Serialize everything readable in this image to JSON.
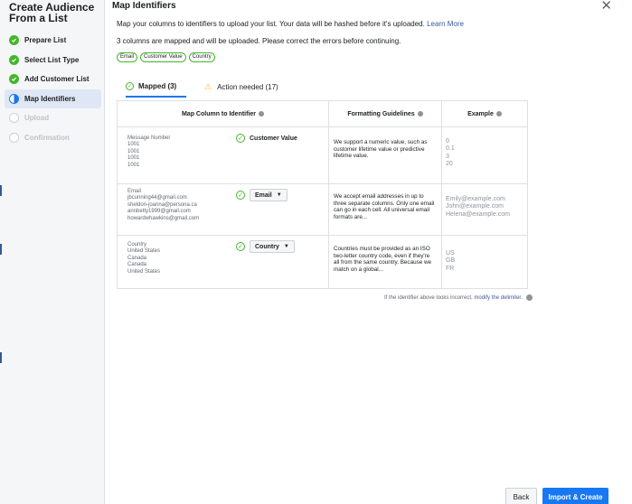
{
  "sidebar": {
    "title": "Create Audience From a List",
    "steps": [
      {
        "label": "Prepare List",
        "state": "done"
      },
      {
        "label": "Select List Type",
        "state": "done"
      },
      {
        "label": "Add Customer List",
        "state": "done"
      },
      {
        "label": "Map Identifiers",
        "state": "current"
      },
      {
        "label": "Upload",
        "state": "pending"
      },
      {
        "label": "Confirmation",
        "state": "pending"
      }
    ]
  },
  "header": {
    "title": "Map Identifiers",
    "close_glyph": "✕"
  },
  "intro": {
    "text": "Map your columns to identifiers to upload your list. Your data will be hashed before it's uploaded.",
    "link": "Learn More"
  },
  "status_line": "3 columns are mapped and will be uploaded. Please correct the errors before continuing.",
  "chips": [
    "Email",
    "Customer Value",
    "Country"
  ],
  "tabs": {
    "mapped": "Mapped (3)",
    "action": "Action needed (17)"
  },
  "table": {
    "headers": {
      "map": "Map Column to Identifier",
      "guidelines": "Formatting Guidelines",
      "example": "Example"
    },
    "rows": [
      {
        "column_values": [
          "Message Number",
          "1001",
          "1001",
          "1001",
          "1001"
        ],
        "identifier": "Customer Value",
        "identifier_type": "static",
        "guideline": "We support a numeric value, such as customer lifetime value or predictive lifetime value.",
        "examples": [
          "0",
          "0.1",
          "3",
          "20"
        ]
      },
      {
        "column_values": [
          "Email",
          "jbcunning44@gmail.com",
          "sheldon-joanna@persona.ca",
          "annbetty1999@gmail.com",
          "howardwhawkins@gmail.com"
        ],
        "identifier": "Email",
        "identifier_type": "dropdown",
        "guideline": "We accept email addresses in up to three separate columns. Only one email can go in each cell. All universal email formats are...",
        "examples": [
          "Emily@example.com",
          "John@example.com",
          "Helena@example.com"
        ]
      },
      {
        "column_values": [
          "Country",
          "United States",
          "Canada",
          "Canada",
          "United States"
        ],
        "identifier": "Country",
        "identifier_type": "dropdown",
        "guideline": "Countries must be provided as an ISO two-letter country code, even if they're all from the same country. Because we match on a global...",
        "examples": [
          "US",
          "GB",
          "FR"
        ]
      }
    ]
  },
  "footnote": {
    "text": "If the identifier above looks incorrect,",
    "link": "modify the delimiter."
  },
  "footer": {
    "back": "Back",
    "primary": "Import & Create"
  },
  "colors": {
    "accent": "#1877f2",
    "success": "#42b72a",
    "warning": "#f7b928",
    "sidebar_bg": "#f5f6f7",
    "active_step_bg": "#dfe7f5"
  }
}
